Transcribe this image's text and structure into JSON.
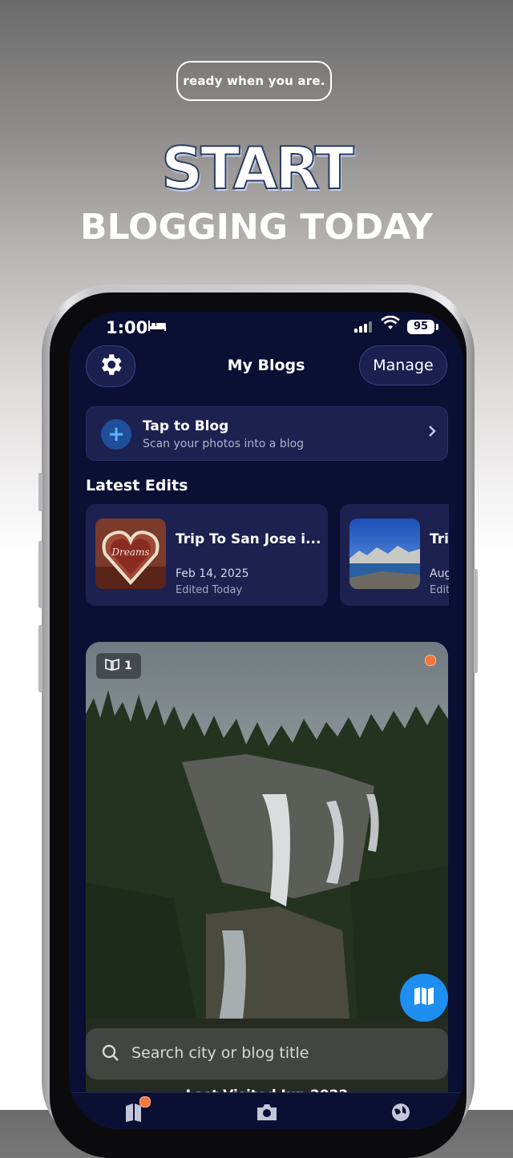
{
  "promo": {
    "tagline": "ready when you are.",
    "headline_main": "START",
    "headline_sub": "BLOGGING TODAY"
  },
  "status_bar": {
    "time": "1:00",
    "battery": "95"
  },
  "nav": {
    "title": "My Blogs",
    "manage_label": "Manage"
  },
  "tap_card": {
    "title": "Tap to Blog",
    "subtitle": "Scan your photos into a blog"
  },
  "latest_edits": {
    "heading": "Latest Edits",
    "items": [
      {
        "title": "Trip To San Jose i...",
        "date": "Feb 14, 2025",
        "edited": "Edited Today"
      },
      {
        "title": "Tri",
        "date": "Aug",
        "edited": "Edit"
      }
    ]
  },
  "featured": {
    "photo_count": "1",
    "last_visited": "Last Visited Jun 2022"
  },
  "search": {
    "placeholder": "Search city or blog title"
  },
  "colors": {
    "screen_bg": "#0a0f33",
    "card_bg": "#1d2150",
    "accent_blue": "#1e8ef0",
    "notification_dot": "#f0783c"
  }
}
